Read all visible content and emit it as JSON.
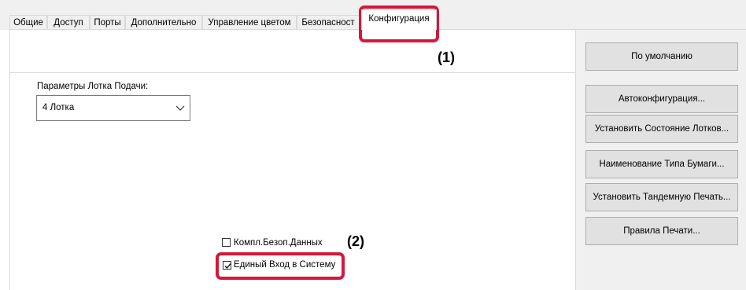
{
  "tabs": [
    {
      "label": "Общие"
    },
    {
      "label": "Доступ"
    },
    {
      "label": "Порты"
    },
    {
      "label": "Дополнительно"
    },
    {
      "label": "Управление цветом"
    },
    {
      "label": "Безопасност"
    },
    {
      "label": "Конфигурация"
    }
  ],
  "active_tab": "Конфигурация",
  "buttons": {
    "defaults": "По умолчанию",
    "autoconfig": "Автоконфигурация...",
    "tray_status": "Установить Состояние Лотков...",
    "paper_type_name": "Наименование Типа Бумаги...",
    "tandem_print": "Установить Тандемную Печать...",
    "print_rules": "Правила Печати..."
  },
  "feed_tray": {
    "label": "Параметры Лотка Подачи:",
    "value": "4 Лотка"
  },
  "checkboxes": {
    "data_security_kit": {
      "label": "Компл.Безоп.Данных",
      "checked": false
    },
    "single_sign_on": {
      "label": "Единый Вход в Систему",
      "checked": true
    }
  },
  "annotations": {
    "one": "(1)",
    "two": "(2)"
  },
  "colors": {
    "highlight": "#d4183b",
    "button_face": "#e1e1e1",
    "panel_bg": "#f0f0f0"
  },
  "icons": {
    "combo_arrow": "chevron-down-icon",
    "checkmark": "check-icon"
  }
}
